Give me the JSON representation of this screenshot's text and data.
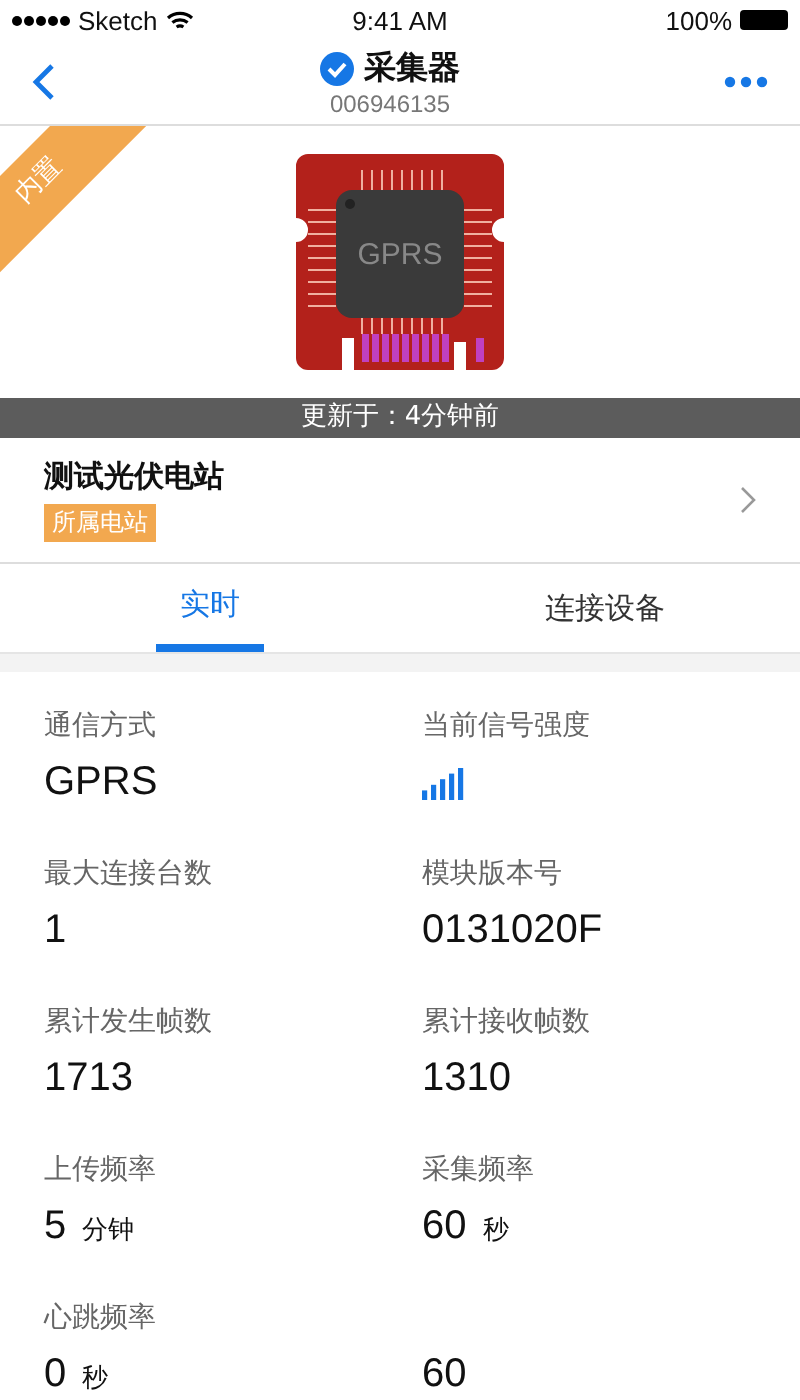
{
  "status_bar": {
    "carrier": "Sketch",
    "time": "9:41 AM",
    "battery": "100%"
  },
  "nav": {
    "title": "采集器",
    "subtitle": "006946135",
    "verified": true
  },
  "device": {
    "corner_tag": "内置",
    "chip_label": "GPRS",
    "updated": "更新于：4分钟前"
  },
  "station": {
    "name": "测试光伏电站",
    "tag": "所属电站"
  },
  "tabs": [
    {
      "label": "实时",
      "selected": true
    },
    {
      "label": "连接设备",
      "selected": false
    }
  ],
  "fields": [
    {
      "kind": "text",
      "label": "通信方式",
      "value": "GPRS"
    },
    {
      "kind": "signal",
      "label": "当前信号强度"
    },
    {
      "kind": "text",
      "label": "最大连接台数",
      "value": "1"
    },
    {
      "kind": "text",
      "label": "模块版本号",
      "value": "0131020F"
    },
    {
      "kind": "text",
      "label": "累计发生帧数",
      "value": "1713"
    },
    {
      "kind": "text",
      "label": "累计接收帧数",
      "value": "1310"
    },
    {
      "kind": "text",
      "label": "上传频率",
      "value": "5",
      "unit": "分钟"
    },
    {
      "kind": "text",
      "label": "采集频率",
      "value": "60",
      "unit": "秒"
    },
    {
      "kind": "text",
      "label": "心跳频率",
      "value": "0",
      "unit": "秒"
    },
    {
      "kind": "text",
      "value": "60"
    }
  ]
}
